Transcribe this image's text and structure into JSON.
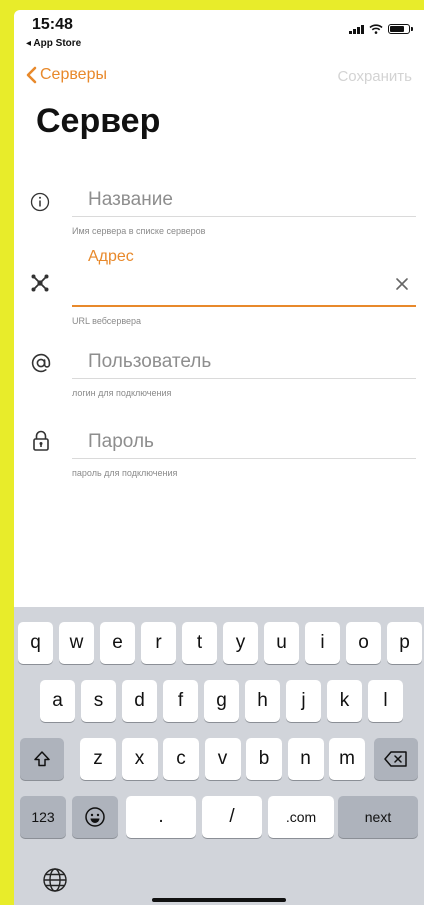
{
  "status": {
    "time": "15:48",
    "back_app": "◂ App Store"
  },
  "nav": {
    "back_label": "Серверы",
    "save_label": "Сохранить",
    "title": "Сервер"
  },
  "fields": {
    "name": {
      "placeholder": "Название",
      "hint": "Имя сервера в списке серверов"
    },
    "address": {
      "label": "Адрес",
      "value": "",
      "hint": "URL вебсервера"
    },
    "user": {
      "placeholder": "Пользователь",
      "hint": "логин для подключения"
    },
    "password": {
      "placeholder": "Пароль",
      "hint": "пароль для подключения"
    }
  },
  "keyboard": {
    "row1": [
      "q",
      "w",
      "e",
      "r",
      "t",
      "y",
      "u",
      "i",
      "o",
      "p"
    ],
    "row2": [
      "a",
      "s",
      "d",
      "f",
      "g",
      "h",
      "j",
      "k",
      "l"
    ],
    "row3": [
      "z",
      "x",
      "c",
      "v",
      "b",
      "n",
      "m"
    ],
    "num_label": "123",
    "dot_label": ".",
    "slash_label": "/",
    "com_label": ".com",
    "next_label": "next"
  },
  "colors": {
    "accent": "#e8892b",
    "frame": "#e8ec2a",
    "keyboard_bg": "#d1d4da"
  }
}
